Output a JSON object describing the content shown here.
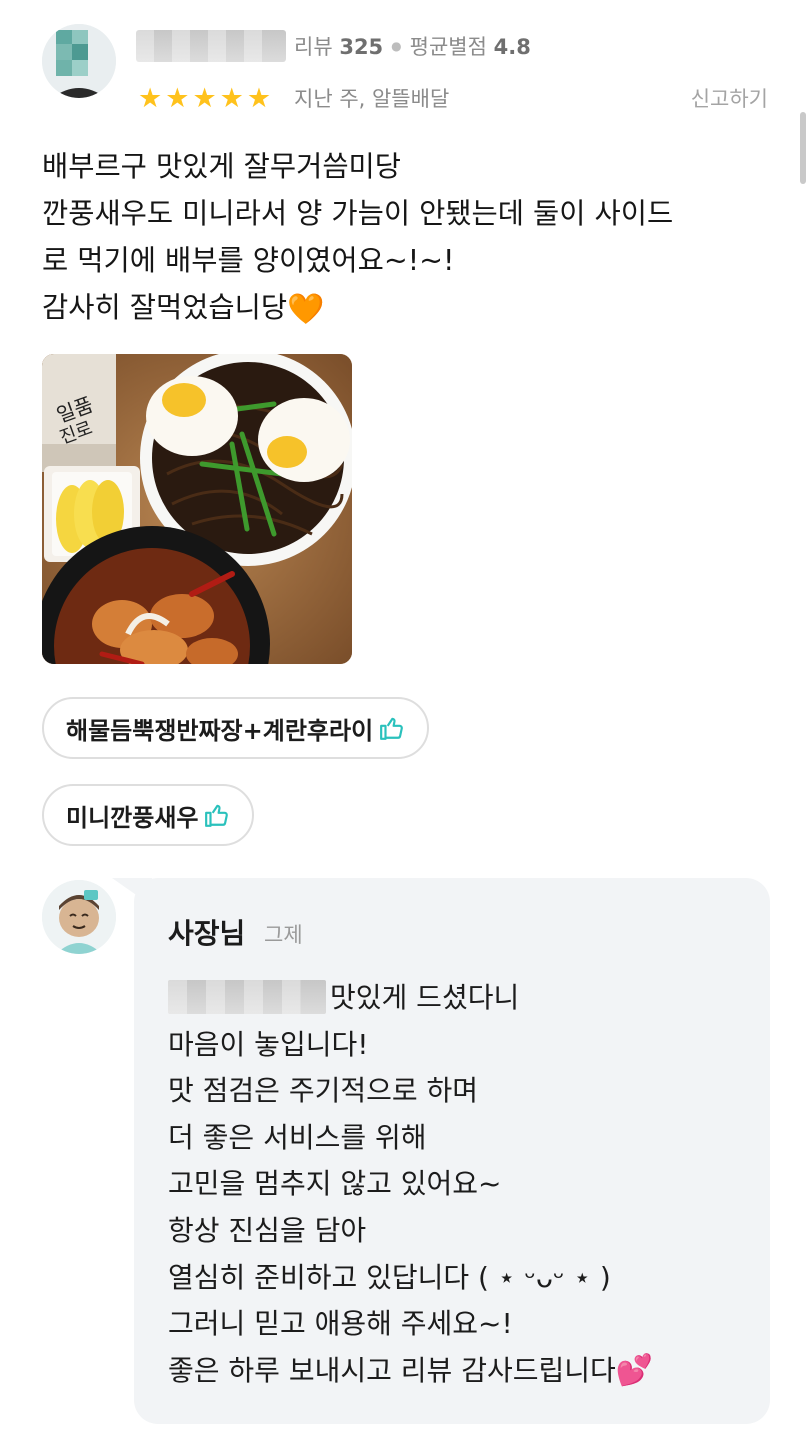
{
  "review": {
    "review_count_label": "리뷰",
    "review_count": "325",
    "avg_rating_label": "평균별점",
    "avg_rating": "4.8",
    "stars": 5,
    "time": "지난 주, 알뜰배달",
    "report_label": "신고하기",
    "lines": [
      "배부르구 맛있게 잘무거씀미당",
      "깐풍새우도 미니라서 양 가늠이 안됐는데 둘이 사이드",
      "로 먹기에 배부를 양이였어요~!~!",
      "감사히 잘먹었습니당"
    ],
    "emoji": "🧡",
    "menu_items": [
      "해물듬뿍쟁반짜장+계란후라이",
      "미니깐풍새우"
    ]
  },
  "reply": {
    "name": "사장님",
    "time": "그제",
    "lines": [
      "맛있게 드셨다니",
      "마음이 놓입니다!",
      "맛 점검은 주기적으로 하며",
      "더 좋은 서비스를 위해",
      "고민을 멈추지 않고 있어요~",
      "항상 진심을 담아",
      "열심히 준비하고 있답니다 ( ⋆ ᵕᴗᵕ ⋆ )",
      "그러니 믿고 애용해 주세요~!",
      "좋은 하루 보내시고 리뷰 감사드립니다"
    ],
    "emoji": "💕"
  },
  "colors": {
    "star": "#ffc21c",
    "thumb_icon": "#2ac1bc",
    "reply_bg": "#f2f4f6"
  }
}
